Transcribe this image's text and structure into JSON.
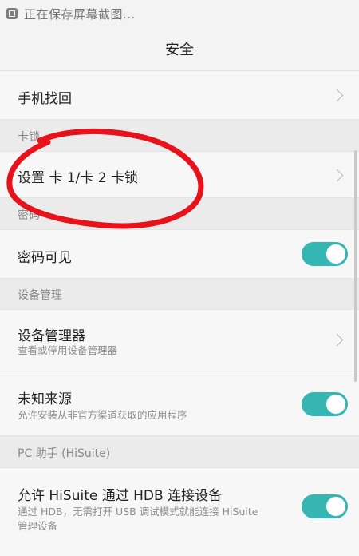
{
  "status_bar": {
    "icon": "gallery-icon",
    "text": "正在保存屏幕截图..."
  },
  "header": {
    "title": "安全"
  },
  "items": {
    "find_phone": {
      "label": "手机找回"
    },
    "sim_section": {
      "label": "卡锁"
    },
    "sim_lock": {
      "label": "设置 卡 1/卡 2 卡锁"
    },
    "password_section": {
      "label": "密码"
    },
    "password_visible": {
      "label": "密码可见",
      "toggle": "on"
    },
    "device_section": {
      "label": "设备管理"
    },
    "device_admin": {
      "label": "设备管理器",
      "sub": "查看或停用设备管理器"
    },
    "unknown_sources": {
      "label": "未知来源",
      "sub": "允许安装从非官方渠道获取的应用程序",
      "toggle": "on"
    },
    "hisuite_section": {
      "label": "PC 助手 (HiSuite)"
    },
    "hisuite_hdb": {
      "label": "允许 HiSuite 通过 HDB 连接设备",
      "sub_line1": "通过 HDB，无需打开 USB 调试模式就能连接 HiSuite",
      "sub_line2": "管理设备",
      "toggle": "on"
    }
  },
  "colors": {
    "toggle_on": "#35b6b3",
    "annotation": "#e8121b",
    "section_bg": "#ebebeb",
    "row_bg": "#f7f7f7"
  }
}
